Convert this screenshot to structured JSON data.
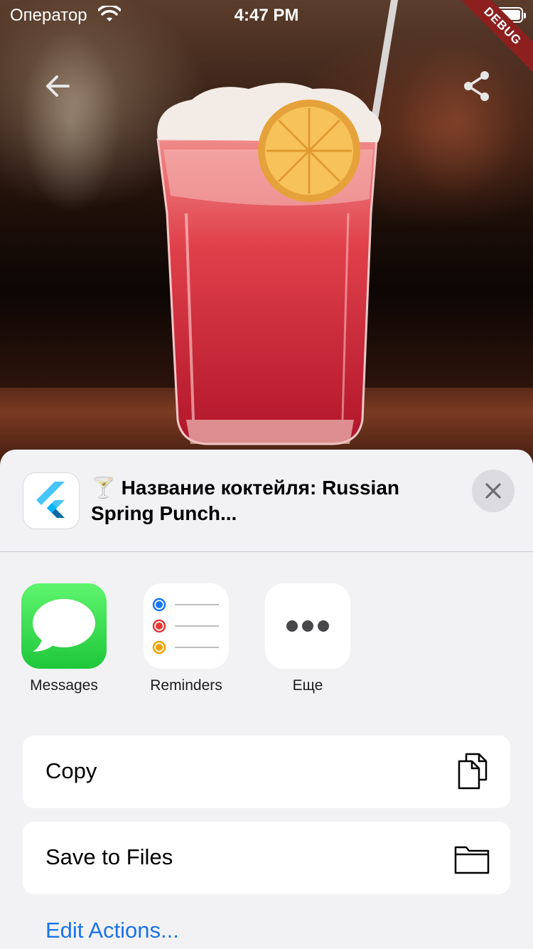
{
  "status_bar": {
    "carrier": "Оператор",
    "time": "4:47 PM"
  },
  "debug_banner": "DEBUG",
  "nav": {
    "back_icon": "arrow-left-icon",
    "share_icon": "share-icon"
  },
  "share_sheet": {
    "title": "🍸 Название коктейля: Russian Spring Punch...",
    "close_icon": "close-icon",
    "apps": [
      {
        "label": "Messages",
        "icon": "messages-icon",
        "color": "#28d246"
      },
      {
        "label": "Reminders",
        "icon": "reminders-icon"
      },
      {
        "label": "Еще",
        "icon": "more-icon"
      }
    ],
    "actions": [
      {
        "label": "Copy",
        "icon": "copy-icon"
      },
      {
        "label": "Save to Files",
        "icon": "folder-icon"
      }
    ],
    "edit_actions": "Edit Actions...",
    "accent_color": "#1a73e8"
  }
}
